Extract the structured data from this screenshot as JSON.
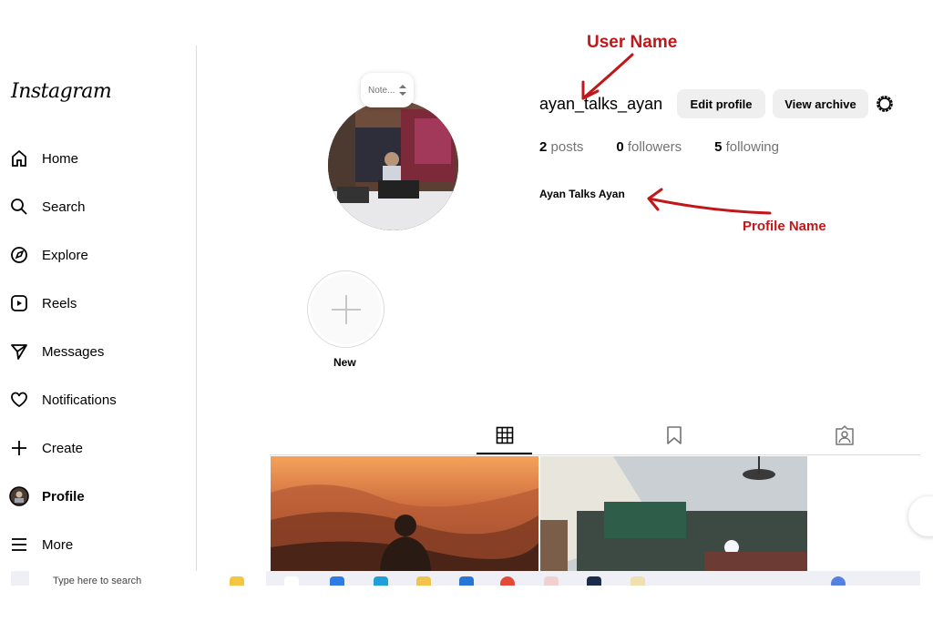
{
  "sidebar": {
    "logo": "Instagram",
    "items": [
      {
        "label": "Home",
        "icon": "home-icon"
      },
      {
        "label": "Search",
        "icon": "search-icon"
      },
      {
        "label": "Explore",
        "icon": "explore-icon"
      },
      {
        "label": "Reels",
        "icon": "reels-icon"
      },
      {
        "label": "Messages",
        "icon": "messages-icon"
      },
      {
        "label": "Notifications",
        "icon": "heart-icon"
      },
      {
        "label": "Create",
        "icon": "plus-icon"
      },
      {
        "label": "Profile",
        "icon": "profile-avatar-icon",
        "active": true
      },
      {
        "label": "More",
        "icon": "menu-icon"
      }
    ]
  },
  "profile": {
    "note_placeholder": "Note...",
    "username": "ayan_talks_ayan",
    "edit_profile": "Edit profile",
    "view_archive": "View archive",
    "settings_icon": "gear-icon",
    "stats": {
      "posts_count": "2",
      "posts_label": "posts",
      "followers_count": "0",
      "followers_label": "followers",
      "following_count": "5",
      "following_label": "following"
    },
    "full_name": "Ayan Talks Ayan",
    "highlight_new": "New"
  },
  "tabs": [
    {
      "icon": "grid-icon",
      "active": true
    },
    {
      "icon": "bookmark-icon",
      "active": false
    },
    {
      "icon": "tagged-icon",
      "active": false
    }
  ],
  "annotations": {
    "user_name": "User Name",
    "profile_name": "Profile Name",
    "color": "#c0171b"
  },
  "taskbar": {
    "search_text": "Type here to search"
  }
}
